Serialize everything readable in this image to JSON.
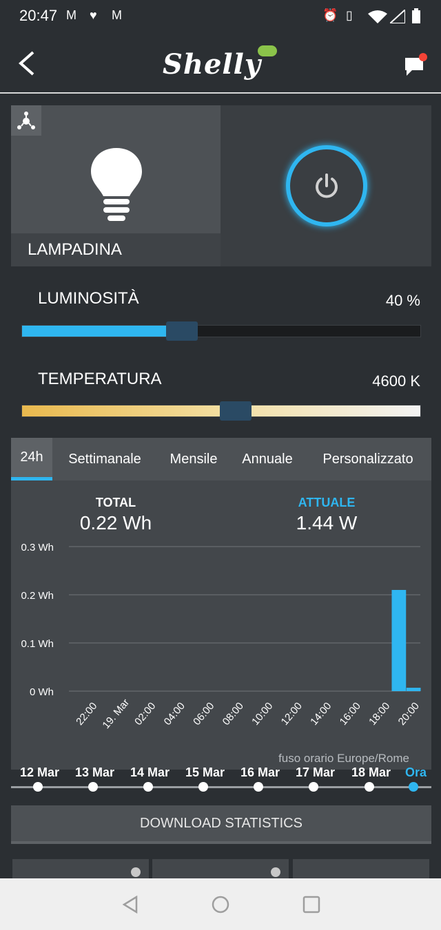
{
  "status_bar": {
    "time": "20:47"
  },
  "device": {
    "name": "LAMPADINA"
  },
  "brightness": {
    "label": "LUMINOSITÀ",
    "value": "40 %",
    "level_percent": 40
  },
  "temperature": {
    "label": "TEMPERATURA",
    "value": "4600 K",
    "level_percent": 50
  },
  "tabs": [
    {
      "label": "24h",
      "active": true
    },
    {
      "label": "Settimanale",
      "active": false
    },
    {
      "label": "Mensile",
      "active": false
    },
    {
      "label": "Annuale",
      "active": false
    },
    {
      "label": "Personalizzato",
      "active": false
    }
  ],
  "stats": {
    "total_label": "TOTAL",
    "total_value": "0.22 Wh",
    "current_label": "ATTUALE",
    "current_value": "1.44 W"
  },
  "chart_data": {
    "type": "bar",
    "y_tick_labels": [
      "0.3 Wh",
      "0.2 Wh",
      "0.1 Wh",
      "0 Wh"
    ],
    "ylim": [
      0,
      0.3
    ],
    "x_tick_labels": [
      "22:00",
      "19. Mar",
      "02:00",
      "04:00",
      "06:00",
      "08:00",
      "10:00",
      "12:00",
      "14:00",
      "16:00",
      "18:00",
      "20:00"
    ],
    "bars": [
      {
        "x": "19:00",
        "value": 0.21
      },
      {
        "x": "20:00",
        "value": 0.007
      }
    ],
    "color": "#2fb6f0",
    "grid": true
  },
  "timezone": "fuso orario Europe/Rome",
  "timeline": {
    "dates": [
      "12 Mar",
      "13 Mar",
      "14 Mar",
      "15 Mar",
      "16 Mar",
      "17 Mar",
      "18 Mar",
      "Ora"
    ],
    "selected_index": 7
  },
  "download_label": "DOWNLOAD STATISTICS",
  "colors": {
    "accent": "#2fb6f0",
    "background": "#2b2f33",
    "logo_cloud": "#8bc34a",
    "notification": "#f44336"
  }
}
